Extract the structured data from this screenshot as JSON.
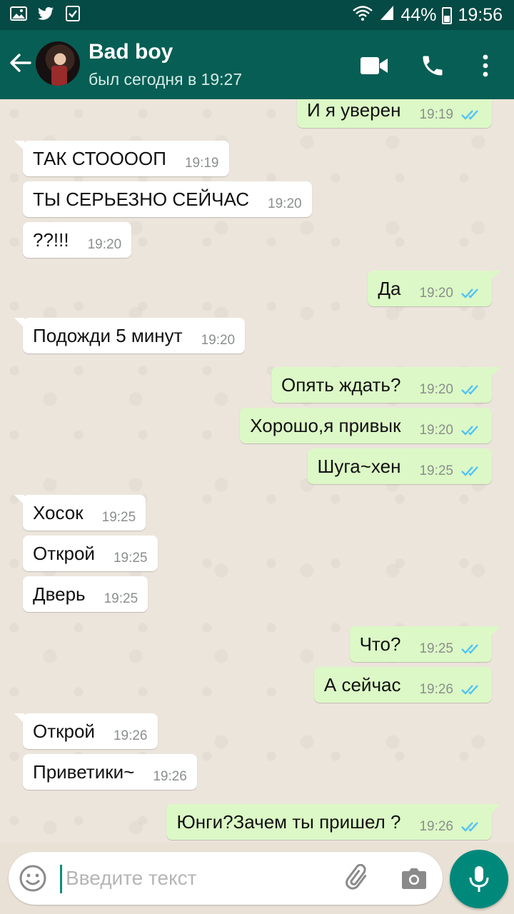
{
  "status_bar": {
    "battery": "44%",
    "time": "19:56"
  },
  "header": {
    "name": "Bad boy",
    "status": "был сегодня в 19:27"
  },
  "colors": {
    "header": "#075e54",
    "status_bar": "#054a44",
    "outgoing": "#dcf8c6",
    "incoming": "#ffffff",
    "read_ticks": "#4fc3f7",
    "mic": "#00897b"
  },
  "messages": [
    {
      "dir": "out",
      "text": "И я уверен",
      "time": "19:19",
      "read": true
    },
    {
      "dir": "in",
      "text": "ТАК СТООООП",
      "time": "19:19"
    },
    {
      "dir": "in",
      "text": "ТЫ СЕРЬЕЗНО СЕЙЧАС",
      "time": "19:20"
    },
    {
      "dir": "in",
      "text": "??!!!",
      "time": "19:20"
    },
    {
      "dir": "out",
      "text": "Да",
      "time": "19:20",
      "read": true
    },
    {
      "dir": "in",
      "text": "Подожди 5 минут",
      "time": "19:20"
    },
    {
      "dir": "out",
      "text": "Опять ждать?",
      "time": "19:20",
      "read": true
    },
    {
      "dir": "out",
      "text": "Хорошо,я привык",
      "time": "19:20",
      "read": true
    },
    {
      "dir": "out",
      "text": "Шуга~хен",
      "time": "19:25",
      "read": true
    },
    {
      "dir": "in",
      "text": "Хосок",
      "time": "19:25"
    },
    {
      "dir": "in",
      "text": "Открой",
      "time": "19:25"
    },
    {
      "dir": "in",
      "text": "Дверь",
      "time": "19:25"
    },
    {
      "dir": "out",
      "text": "Что?",
      "time": "19:25",
      "read": true
    },
    {
      "dir": "out",
      "text": "А сейчас",
      "time": "19:26",
      "read": true
    },
    {
      "dir": "in",
      "text": "Открой",
      "time": "19:26"
    },
    {
      "dir": "in",
      "text": "Приветики~",
      "time": "19:26"
    },
    {
      "dir": "out",
      "text": "Юнги?Зачем ты пришел ?",
      "time": "19:26",
      "read": true
    }
  ],
  "composer": {
    "placeholder": "Введите текст",
    "value": ""
  },
  "icons": {
    "status_left": [
      "image-icon",
      "twitter-icon",
      "checkbox-icon"
    ],
    "status_right": [
      "wifi-icon",
      "signal-icon",
      "battery-icon"
    ],
    "header": [
      "back-arrow-icon",
      "video-call-icon",
      "phone-icon",
      "more-vertical-icon"
    ],
    "composer": [
      "emoji-icon",
      "attach-icon",
      "camera-icon",
      "mic-icon"
    ]
  }
}
